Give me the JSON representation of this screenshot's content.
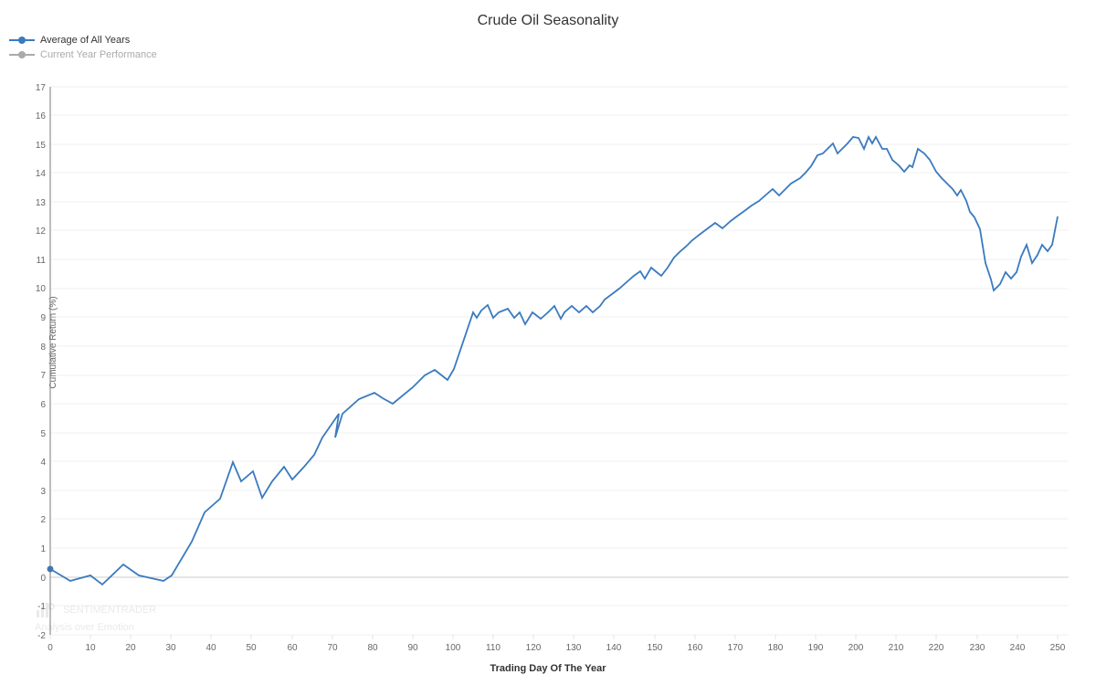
{
  "title": "Crude Oil Seasonality",
  "legend": {
    "item1": {
      "label": "Average of All Years",
      "color": "#3a7abf",
      "type": "blue"
    },
    "item2": {
      "label": "Current Year Performance",
      "color": "#aaa",
      "type": "gray"
    }
  },
  "axes": {
    "y_label": "Cumulative Return (%)",
    "x_label": "Trading Day Of The Year",
    "y_min": -2,
    "y_max": 17,
    "x_ticks": [
      0,
      10,
      20,
      30,
      40,
      50,
      60,
      70,
      80,
      90,
      100,
      110,
      120,
      130,
      140,
      150,
      160,
      170,
      180,
      190,
      200,
      210,
      220,
      230,
      240,
      250
    ],
    "y_ticks": [
      -2,
      -1,
      0,
      1,
      2,
      3,
      4,
      5,
      6,
      7,
      8,
      9,
      10,
      11,
      12,
      13,
      14,
      15,
      16,
      17
    ]
  },
  "watermark": {
    "line1": "SENTIMENTRADER",
    "line2": "Analysis over Emotion"
  }
}
